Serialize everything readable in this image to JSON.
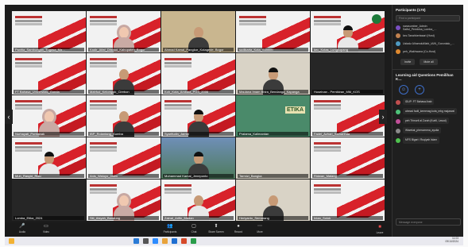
{
  "participants_panel": {
    "title": "Participants (170)",
    "search_placeholder": "Find a participant",
    "rows": [
      {
        "label": "narasumber_Admin Saiful_Pembina_Lomba_…"
      },
      {
        "label": "kec.Tanahkertasari (Host)"
      },
      {
        "label": "Ustadz Alhamdulillahi_IAIN_Gorontalo_…"
      },
      {
        "label": "peh_Wakhwana (Co-Host)"
      }
    ],
    "invite_label": "Invite",
    "mute_all_label": "Mute all"
  },
  "chat": {
    "title": "Learning aid Questions Pemilihan K…",
    "messages": [
      {
        "text": "IDUP: FT Bahasa Arab"
      },
      {
        "text": "ahmad fadil_kemenag kota_mbg majarwal"
      },
      {
        "text": "peh Trimurti al Zurah (Kurtil, Lavud)"
      },
      {
        "text": "Wiwekat_phenomena_ayulia"
      },
      {
        "text": "MFS Bigari / Ruqiyah Islam"
      }
    ],
    "input_placeholder": "Message everyone"
  },
  "tiles": [
    {
      "name": "Panitia_Sambungan_Tugasa_Ma…"
    },
    {
      "name": "Kadir_Aifaf_Dilshad_Kabupaten_Bogor"
    },
    {
      "name": "Ahmad Kamal_Pangkor_Kotagede, Bogor"
    },
    {
      "name": "sudikarta_Kota_Sumber"
    },
    {
      "name": "kec_Kotas_Lungkupang"
    },
    {
      "name": "FT Bahasa_Universitas_Gonda"
    },
    {
      "name": "Mahfud_Kelompok_Cirebon"
    },
    {
      "name": "Koh_Kota_Ambala_PGS_2006"
    },
    {
      "name": "Maulana Imam Bhira_Bendanga_Kapanga"
    },
    {
      "name": "Huseinan - Pemikiran_MM_KOS"
    },
    {
      "name": "Nurhayati_Pontianak"
    },
    {
      "name": "IBP_Rolantang_Sumba"
    },
    {
      "name": "Syarifudin_Jambi"
    },
    {
      "name": "Pratama_Kalimantan"
    },
    {
      "name": "Fadel_Azhari_Samarinda"
    },
    {
      "name": "Muh_Rasyid_Riau"
    },
    {
      "name": "Anis_Waluyo_Jatim"
    },
    {
      "name": "Muhammad Kamal_Jeneponto"
    },
    {
      "name": "Tarmizi_Bangka"
    },
    {
      "name": "Ridwan_Malang"
    },
    {
      "name": "Lomba_Etika_2024"
    },
    {
      "name": "Siti_Aisyah_Bandung"
    },
    {
      "name": "Zainal_Arifin_Medan"
    },
    {
      "name": "Heriyanto_Semarang"
    },
    {
      "name": "Intan_Solok"
    }
  ],
  "etika_label": "ETIKA",
  "toolbar": {
    "audio": "Audio",
    "video": "Video",
    "participants": "Participants",
    "participants_count": "170",
    "chat": "Chat",
    "share": "Share Screen",
    "record": "Record",
    "more": "More",
    "leave": "Leave"
  },
  "taskbar": {
    "clock_time": "11:03",
    "clock_date": "09/10/2024"
  },
  "colors": {
    "accent_red": "#d8222a",
    "panel_bg": "#1f1f1f",
    "leave_red": "#e84a4a"
  }
}
